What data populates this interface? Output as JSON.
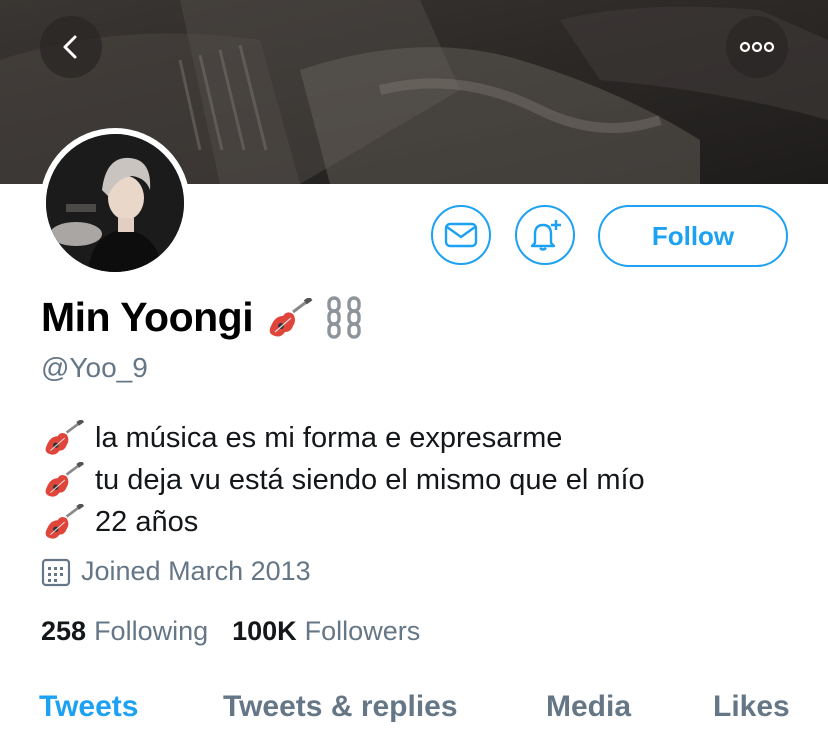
{
  "header": {
    "back_icon": "chevron-left-icon",
    "more_icon": "more-dots-icon"
  },
  "actions": {
    "message_icon": "mail-icon",
    "notify_icon": "bell-plus-icon",
    "follow_label": "Follow",
    "accent_color": "#1da1f2"
  },
  "profile": {
    "display_name": "Min Yoongi",
    "name_emojis": [
      "guitar-emoji",
      "chains-emoji"
    ],
    "handle": "@Yoo_9",
    "bio_lines": [
      {
        "emoji": "guitar-emoji",
        "text": "la música es mi forma e expresarme"
      },
      {
        "emoji": "guitar-emoji",
        "text": "tu deja vu está siendo el mismo que el mío"
      },
      {
        "emoji": "guitar-emoji",
        "text": "22 años"
      }
    ],
    "joined_icon": "calendar-icon",
    "joined_text": "Joined March 2013"
  },
  "stats": {
    "following_count": "258",
    "following_label": "Following",
    "followers_count": "100K",
    "followers_label": "Followers"
  },
  "tabs": [
    {
      "label": "Tweets",
      "active": true
    },
    {
      "label": "Tweets & replies",
      "active": false
    },
    {
      "label": "Media",
      "active": false
    },
    {
      "label": "Likes",
      "active": false
    }
  ],
  "colors": {
    "secondary_text": "#657786",
    "primary_text": "#14171a"
  }
}
